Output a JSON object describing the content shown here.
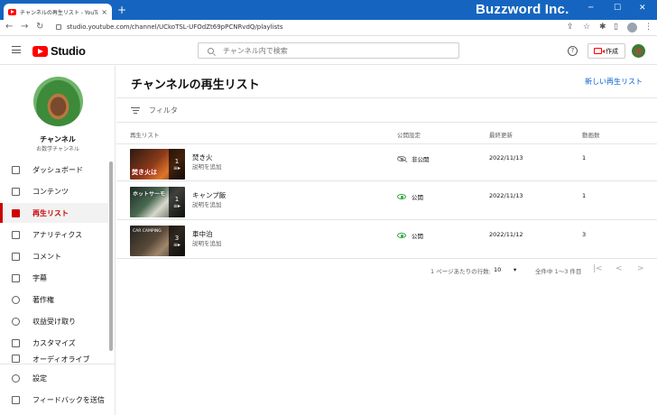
{
  "browser": {
    "tab_title": "チャンネルの再生リスト - YouTube S",
    "tab_close": "×",
    "new_tab": "+",
    "brand": "Buzzword Inc.",
    "url": "studio.youtube.com/channel/UCkoTSL-UFOdZt69pPCNRvdQ/playlists",
    "controls": {
      "minimize": "─",
      "maximize": "☐",
      "close": "✕"
    },
    "nav": {
      "back": "←",
      "forward": "→",
      "reload": "↻"
    },
    "tab_bar_color": "#1565c0"
  },
  "header": {
    "logo_text": "Studio",
    "search_placeholder": "チャンネル内で検索",
    "help": "?",
    "create_label": "作成",
    "brand_red": "#ff0000"
  },
  "sidebar": {
    "channel_name": "チャンネル",
    "channel_sub": "お数学チャンネル",
    "items": [
      {
        "label": "ダッシュボード",
        "icon": "dashboard-icon"
      },
      {
        "label": "コンテンツ",
        "icon": "content-icon"
      },
      {
        "label": "再生リスト",
        "icon": "playlist-icon",
        "active": true
      },
      {
        "label": "アナリティクス",
        "icon": "analytics-icon"
      },
      {
        "label": "コメント",
        "icon": "comment-icon"
      },
      {
        "label": "字幕",
        "icon": "subtitles-icon"
      },
      {
        "label": "著作権",
        "icon": "copyright-icon"
      },
      {
        "label": "収益受け取り",
        "icon": "monetization-icon"
      },
      {
        "label": "カスタマイズ",
        "icon": "customize-icon"
      },
      {
        "label": "オーディオライブ",
        "icon": "audio-library-icon"
      }
    ],
    "bottom": [
      {
        "label": "設定",
        "icon": "settings-icon"
      },
      {
        "label": "フィードバックを送信",
        "icon": "feedback-icon"
      }
    ],
    "active_color": "#cc0000"
  },
  "main": {
    "title": "チャンネルの再生リスト",
    "new_playlist": "新しい再生リスト",
    "filter": "フィルタ",
    "columns": {
      "playlist": "再生リスト",
      "visibility": "公開設定",
      "updated": "最終更新",
      "count": "動画数"
    },
    "rows": [
      {
        "title": "焚き火",
        "sub": "説明を追加",
        "visibility": "非公開",
        "vis_type": "private",
        "updated": "2022/11/13",
        "count": "1",
        "thumb_count": "1",
        "thumb_caption": "焚き火は"
      },
      {
        "title": "キャンプ飯",
        "sub": "説明を追加",
        "visibility": "公開",
        "vis_type": "public",
        "updated": "2022/11/13",
        "count": "1",
        "thumb_count": "1",
        "thumb_caption": "ホットサーモ"
      },
      {
        "title": "車中泊",
        "sub": "説明を追加",
        "visibility": "公開",
        "vis_type": "public",
        "updated": "2022/11/12",
        "count": "3",
        "thumb_count": "3",
        "thumb_caption": "CAR CAMPING"
      }
    ],
    "pager": {
      "rows_per_page_label": "1 ページあたりの行数:",
      "rows_per_page": "10",
      "range": "全件中 1～3 件目",
      "first": "|<",
      "prev": "<",
      "next": ">",
      "last": ">|"
    },
    "link_color": "#065fd4",
    "public_color": "#2ba640"
  }
}
